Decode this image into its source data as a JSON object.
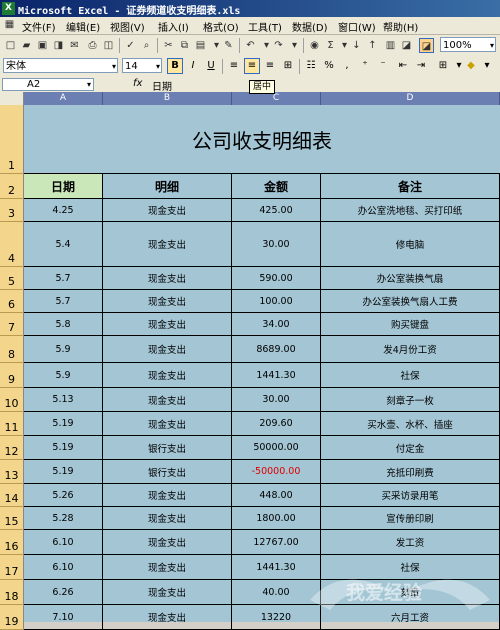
{
  "window": {
    "title": "Microsoft Excel - 证券频道收支明细表.xls"
  },
  "menu": [
    "文件(F)",
    "编辑(E)",
    "视图(V)",
    "插入(I)",
    "格式(O)",
    "工具(T)",
    "数据(D)",
    "窗口(W)",
    "帮助(H)"
  ],
  "toolbar": {
    "zoom": "100%"
  },
  "format_toolbar": {
    "font": "宋体",
    "size": "14",
    "bold": "B",
    "italic": "I",
    "underline": "U",
    "percent": "%"
  },
  "formula_bar": {
    "name_box": "A2",
    "fx": "fx",
    "content": "日期"
  },
  "tooltip": "居中",
  "columns": [
    "A",
    "B",
    "C",
    "D"
  ],
  "rows": [
    "1",
    "2",
    "3",
    "4",
    "5",
    "6",
    "7",
    "8",
    "9",
    "10",
    "11",
    "12",
    "13",
    "14",
    "15",
    "16",
    "17",
    "18",
    "19"
  ],
  "sheet": {
    "title": "公司收支明细表",
    "headers": [
      "日期",
      "明细",
      "金额",
      "备注"
    ],
    "data": [
      [
        "4.25",
        "现金支出",
        "425.00",
        "办公室洗地毯、买打印纸"
      ],
      [
        "5.4",
        "现金支出",
        "30.00",
        "修电脑"
      ],
      [
        "5.7",
        "现金支出",
        "590.00",
        "办公室装换气扇"
      ],
      [
        "5.7",
        "现金支出",
        "100.00",
        "办公室装换气扇人工费"
      ],
      [
        "5.8",
        "现金支出",
        "34.00",
        "购买键盘"
      ],
      [
        "5.9",
        "现金支出",
        "8689.00",
        "发4月份工资"
      ],
      [
        "5.9",
        "现金支出",
        "1441.30",
        "社保"
      ],
      [
        "5.13",
        "现金支出",
        "30.00",
        "刻章子一枚"
      ],
      [
        "5.19",
        "现金支出",
        "209.60",
        "买水壶、水杯、插座"
      ],
      [
        "5.19",
        "银行支出",
        "50000.00",
        "付定金"
      ],
      [
        "5.19",
        "银行支出",
        "-50000.00",
        "充抵印刷费"
      ],
      [
        "5.26",
        "现金支出",
        "448.00",
        "买采访录用笔"
      ],
      [
        "5.28",
        "现金支出",
        "1800.00",
        "宣传册印刷"
      ],
      [
        "6.10",
        "现金支出",
        "12767.00",
        "发工资"
      ],
      [
        "6.10",
        "现金支出",
        "1441.30",
        "社保"
      ],
      [
        "6.26",
        "现金支出",
        "40.00",
        "刻章"
      ],
      [
        "7.10",
        "现金支出",
        "13220",
        "六月工资"
      ]
    ]
  },
  "watermark": "我爱经验"
}
